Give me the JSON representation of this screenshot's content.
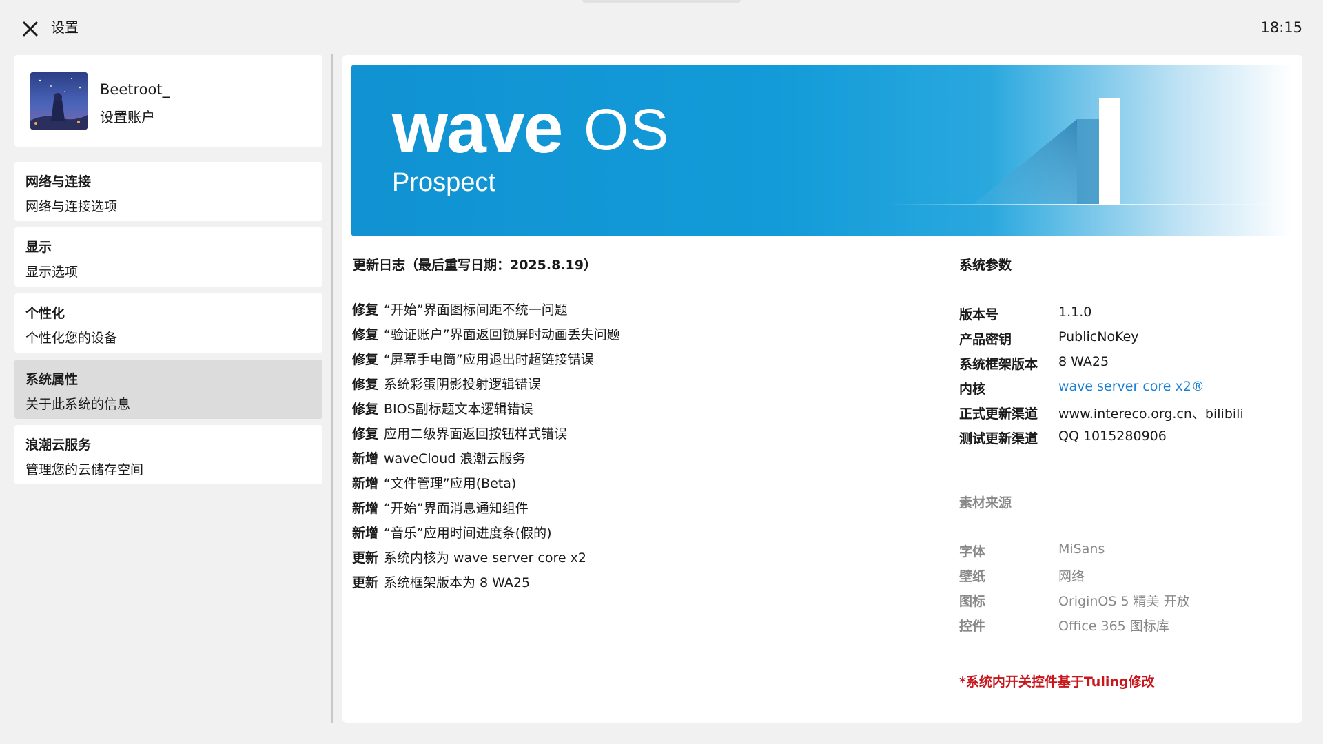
{
  "titlebar": {
    "title": "设置",
    "clock": "18:15"
  },
  "account": {
    "name": "Beetroot_",
    "subtitle": "设置账户"
  },
  "sidebar": {
    "items": [
      {
        "title": "网络与连接",
        "subtitle": "网络与连接选项"
      },
      {
        "title": "显示",
        "subtitle": "显示选项"
      },
      {
        "title": "个性化",
        "subtitle": "个性化您的设备"
      },
      {
        "title": "系统属性",
        "subtitle": "关于此系统的信息",
        "active": true
      },
      {
        "title": "浪潮云服务",
        "subtitle": "管理您的云储存空间"
      }
    ]
  },
  "banner": {
    "logo_wave": "wave",
    "logo_os": "OS",
    "subtitle": "Prospect",
    "version_digit": "1"
  },
  "changelog": {
    "title": "更新日志（最后重写日期：2025.8.19）",
    "items": [
      {
        "tag": "修复",
        "text": "“开始”界面图标间距不统一问题"
      },
      {
        "tag": "修复",
        "text": "“验证账户”界面返回锁屏时动画丢失问题"
      },
      {
        "tag": "修复",
        "text": "“屏幕手电筒”应用退出时超链接错误"
      },
      {
        "tag": "修复",
        "text": "系统彩蛋阴影投射逻辑错误"
      },
      {
        "tag": "修复",
        "text": "BIOS副标题文本逻辑错误"
      },
      {
        "tag": "修复",
        "text": "应用二级界面返回按钮样式错误"
      },
      {
        "tag": "新增",
        "text": "waveCloud 浪潮云服务"
      },
      {
        "tag": "新增",
        "text": "“文件管理”应用(Beta)"
      },
      {
        "tag": "新增",
        "text": "“开始”界面消息通知组件"
      },
      {
        "tag": "新增",
        "text": "“音乐”应用时间进度条(假的)"
      },
      {
        "tag": "更新",
        "text": "系统内核为 wave server core x2"
      },
      {
        "tag": "更新",
        "text": "系统框架版本为 8 WA25"
      }
    ]
  },
  "system": {
    "title": "系统参数",
    "params": [
      {
        "key": "版本号",
        "value": "1.1.0"
      },
      {
        "key": "产品密钥",
        "value": "PublicNoKey"
      },
      {
        "key": "系统框架版本",
        "value": "8 WA25"
      },
      {
        "key": "内核",
        "value": "wave server core x2®",
        "link": true
      },
      {
        "key": "正式更新渠道",
        "value": "www.intereco.org.cn、bilibili"
      },
      {
        "key": "测试更新渠道",
        "value": "QQ 1015280906"
      }
    ]
  },
  "sources": {
    "title": "素材来源",
    "items": [
      {
        "key": "字体",
        "value": "MiSans"
      },
      {
        "key": "壁纸",
        "value": "网络"
      },
      {
        "key": "图标",
        "value": "OriginOS 5 精美 开放"
      },
      {
        "key": "控件",
        "value": "Office 365 图标库"
      }
    ]
  },
  "note": "*系统内开关控件基于Tuling修改",
  "colors": {
    "accent_link": "#1a7fd6",
    "note_red": "#c8161d",
    "banner_blue": "#1192d2",
    "active_item": "#dcdcdc"
  }
}
